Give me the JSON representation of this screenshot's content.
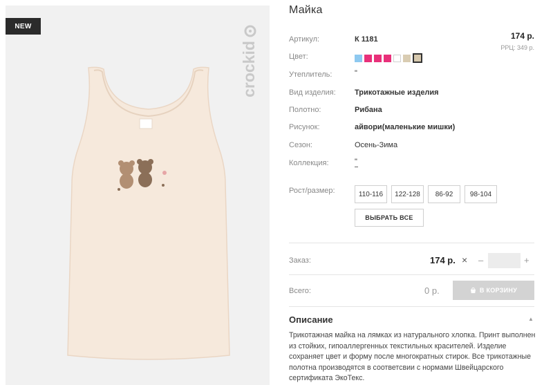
{
  "badge": {
    "label": "NEW"
  },
  "brand": {
    "text": "crockid"
  },
  "product": {
    "title": "Майка",
    "price": "174 р.",
    "rrc": "РРЦ: 349 р."
  },
  "specs": [
    {
      "label": "Артикул:",
      "value": "К 1181"
    },
    {
      "label": "Цвет:"
    },
    {
      "label": "Утеплитель:",
      "value": "\""
    },
    {
      "label": "Вид изделия:",
      "value": "Трикотажные изделия"
    },
    {
      "label": "Полотно:",
      "value": "Рибана"
    },
    {
      "label": "Рисунок:",
      "value": "айвори(маленькие мишки)"
    },
    {
      "label": "Сезон:",
      "value": "Осень-Зима"
    },
    {
      "label": "Коллекция:",
      "value": "\""
    }
  ],
  "colors": [
    "#8ec9f0",
    "#e8307a",
    "#e8307a",
    "#e8307a",
    "#ffffff",
    "#d9ccb2",
    "#d7c9ae"
  ],
  "sizes": {
    "label": "Рост/размер:",
    "options": [
      "110-116",
      "122-128",
      "86-92",
      "98-104"
    ],
    "select_all": "ВЫБРАТЬ ВСЕ"
  },
  "order": {
    "label": "Заказ:",
    "price": "174 р.",
    "times": "×",
    "minus": "–",
    "plus": "+"
  },
  "total": {
    "label": "Всего:",
    "value": "0 р.",
    "cart_button": "В КОРЗИНУ"
  },
  "description": {
    "title": "Описание",
    "toggle": "▲",
    "text": "Трикотажная майка на лямках из натурального хлопка. Принт выполнен из стойких, гипоаллергенных текстильных красителей. Изделие сохраняет цвет и форму после многократных стирок. Все трикотажные полотна производятся в соответсвии с нормами Швейцарского сертификата ЭкоТекс."
  }
}
